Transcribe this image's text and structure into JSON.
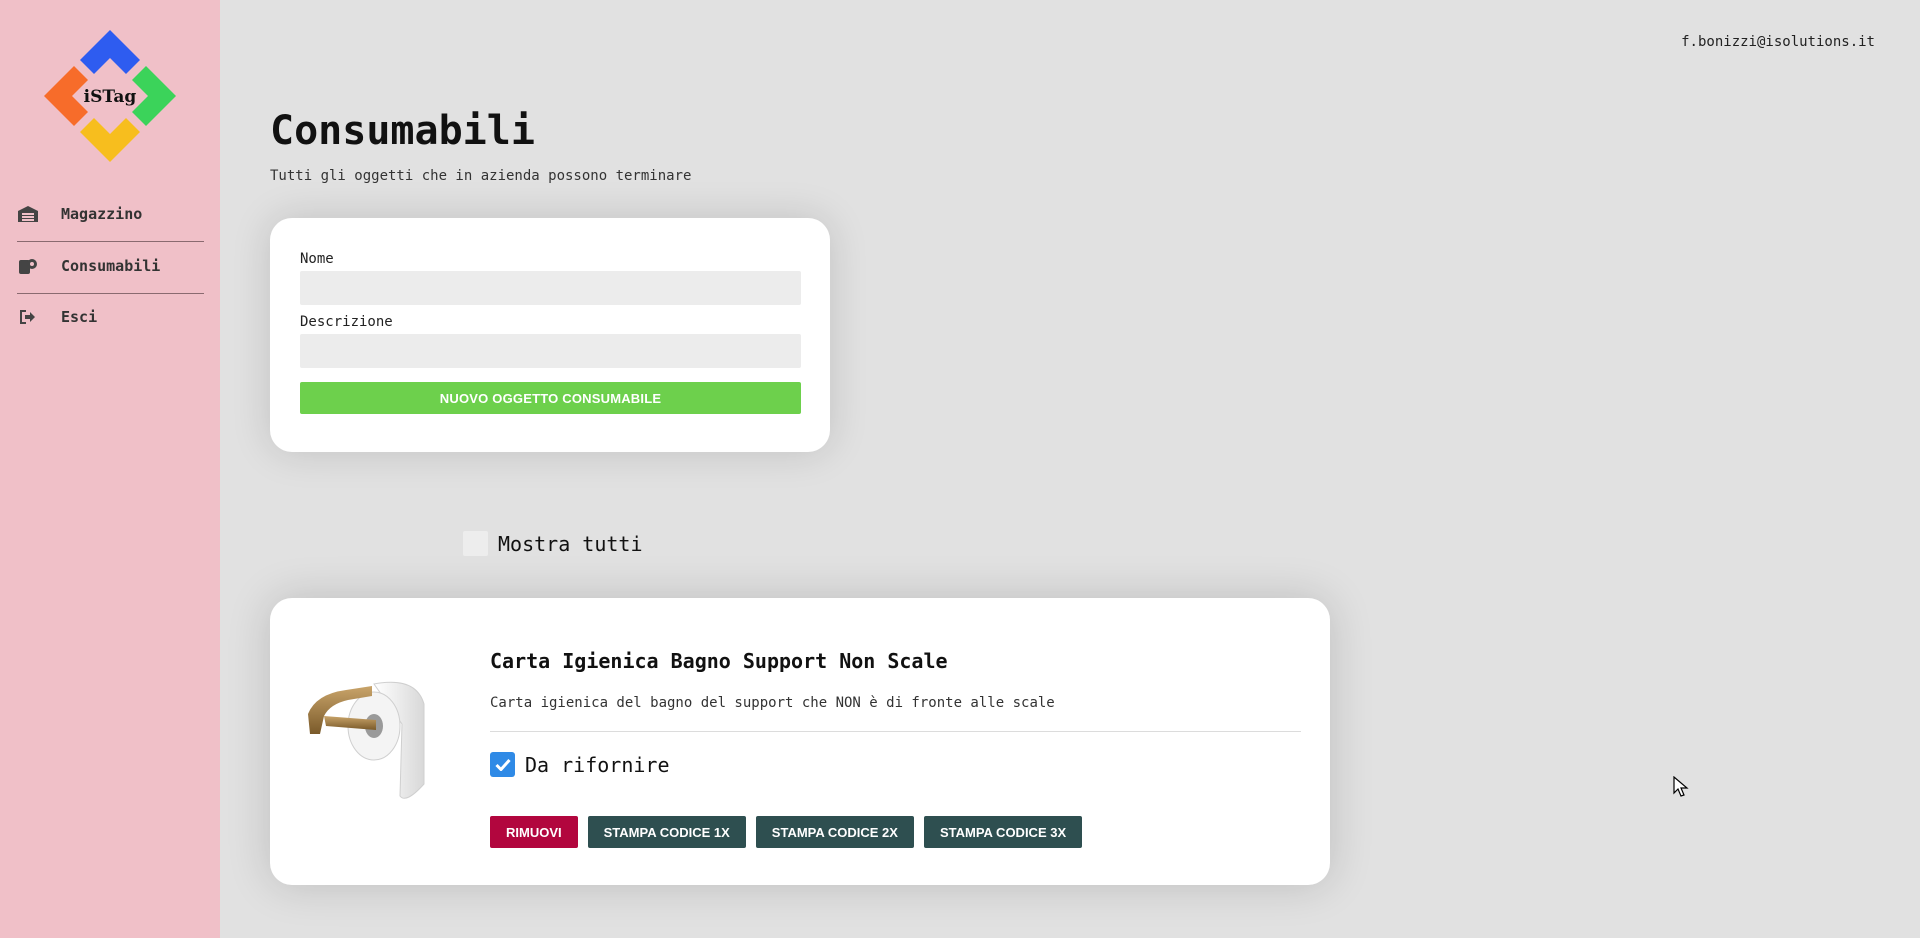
{
  "app": {
    "logo_text": "iSTag",
    "colors": {
      "sidebar": "#f0c0c8",
      "primary": "#6dd04c",
      "danger": "#b2063e",
      "secondary": "#2e4f50",
      "check": "#2f8ae6"
    }
  },
  "header": {
    "user_email": "f.bonizzi@isolutions.it"
  },
  "sidebar": {
    "items": [
      {
        "label": "Magazzino",
        "icon": "warehouse-icon"
      },
      {
        "label": "Consumabili",
        "icon": "toilet-paper-icon"
      },
      {
        "label": "Esci",
        "icon": "sign-out-icon"
      }
    ]
  },
  "page": {
    "title": "Consumabili",
    "subtitle": "Tutti gli oggetti che in azienda possono terminare"
  },
  "form": {
    "name_label": "Nome",
    "name_value": "",
    "description_label": "Descrizione",
    "description_value": "",
    "submit_label": "NUOVO OGGETTO CONSUMABILE"
  },
  "filter": {
    "show_all_label": "Mostra tutti",
    "show_all_checked": false
  },
  "items": [
    {
      "title": "Carta Igienica Bagno Support Non Scale",
      "description": "Carta igienica del bagno del support che NON è di fronte alle scale",
      "restock_label": "Da rifornire",
      "restock_checked": true,
      "image": "toilet-paper-holder",
      "actions": {
        "remove": "RIMUOVI",
        "print1": "STAMPA CODICE 1X",
        "print2": "STAMPA CODICE 2X",
        "print3": "STAMPA CODICE 3X"
      }
    }
  ]
}
